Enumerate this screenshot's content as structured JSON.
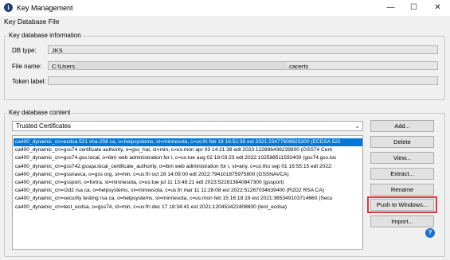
{
  "window": {
    "title": "Key Management",
    "icon": "info-icon",
    "controls": [
      "minimize-icon",
      "maximize-icon",
      "close-icon"
    ]
  },
  "menu": {
    "items": [
      "Key Database File"
    ]
  },
  "info": {
    "legend": "Key database information",
    "db_type_label": "DB type:",
    "db_type_value": "JKS",
    "file_name_label": "File name:",
    "file_name_prefix": "C:\\Users",
    "file_name_suffix": ".cacerts",
    "token_label": "Token label:",
    "token_value": ""
  },
  "content": {
    "legend": "Key database content",
    "selected_type": "Trusted Certificates",
    "certificates": [
      "ca400_dynamic_cn=ecdsa 521 sha-256 ca, o=helpsystems, st=minnesota, c=us:fri feb 19 16:51:39 est 2021:23477608823200 (ECDSA 521",
      "ca400_dynamic_cn=gss74 certificate authority, o=gss_hal, st=min, c=us:mon apr 03 14:21:38 edt 2023:122886436239900 (GSS74 Certi",
      "ca400_dynamic_cn=gss74.gss.local, o=ibm web administration for i, c=us:tue aug 02 18:03:23 edt 2022:102588511592400 (gss74.gss.loc",
      "ca400_dynamic_cn=gss742.gssqa.local_certificate_authority, o=ibm web administration for i, st=any, c=us:thu sep 01 16:55:15 edt 2022:",
      "ca400_dynamic_cn=gssnavca, o=gss org, st=min, c=us:fri oct 28 14:09:00 edt 2022:794101875975800 (GSSNAVCA)",
      "ca400_dynamic_cn=gssport, o=fortra, st=minnesota, c=us:tue jul 11 13:48:21 edt 2023:522813840847300 (gssport)",
      "ca400_dynamic_cn=r2d2 rsa ca, o=helpsystems, st=minnesota, c=us:fri mar 11 11:28:08 est 2022:51267034639400 (R2D2 RSA CA)",
      "ca400_dynamic_cn=security testing rsa ca, o=helpsystems, st=minnesota, c=us:mon feb 15 16:18:19 est 2021:365349103714660 (Secu",
      "ca400_dynamic_cn=test_ecdsa, o=gss74, st=min, c=us:fri dec 17 18:34:41 est 2021:120453422408800 (test_ecdsa)"
    ],
    "selected_index": 0
  },
  "buttons": {
    "add": "Add...",
    "delete": "Delete",
    "view": "View...",
    "extract": "Extract...",
    "rename": "Rename",
    "push": "Push to Windows...",
    "import": "Import..."
  },
  "colors": {
    "selection": "#0078d7",
    "highlight_box": "#e03a3a",
    "help_icon": "#1a6fd0"
  }
}
